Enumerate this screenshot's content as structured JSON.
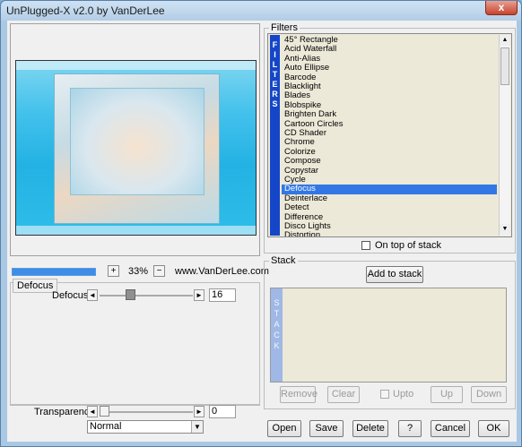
{
  "window": {
    "title": "UnPlugged-X v2.0 by VanDerLee",
    "close_label": "x"
  },
  "preview": {
    "zoom": "33%",
    "zoom_in": "+",
    "zoom_out": "−",
    "website": "www.VanDerLee.com",
    "progress": 1.0
  },
  "defocus_panel": {
    "group_label": "Defocus",
    "param_label": "Defocus",
    "value": "16",
    "left_arrow": "◄",
    "right_arrow": "►"
  },
  "transparency": {
    "label": "Transparency",
    "value": "0",
    "left_arrow": "◄",
    "right_arrow": "►"
  },
  "blend_mode": {
    "selected": "Normal",
    "arrow": "▼"
  },
  "filters": {
    "group_label": "Filters",
    "tab_letters": [
      "F",
      "I",
      "L",
      "T",
      "E",
      "R",
      "S"
    ],
    "items": [
      "45° Rectangle",
      "Acid Waterfall",
      "Anti-Alias",
      "Auto Ellipse",
      "Barcode",
      "Blacklight",
      "Blades",
      "Blobspike",
      "Brighten Dark",
      "Cartoon Circles",
      "CD Shader",
      "Chrome",
      "Colorize",
      "Compose",
      "Copystar",
      "Cycle",
      "Defocus",
      "Deinterlace",
      "Detect",
      "Difference",
      "Disco Lights",
      "Distortion"
    ],
    "selected": "Defocus",
    "on_top_label": "On top of stack",
    "scroll_up": "▲",
    "scroll_down": "▼"
  },
  "stack": {
    "group_label": "Stack",
    "add_button": "Add to stack",
    "tab_letters": [
      "S",
      "T",
      "A",
      "C",
      "K"
    ],
    "remove": "Remove",
    "clear": "Clear",
    "upto": "Upto",
    "up": "Up",
    "down": "Down"
  },
  "footer": {
    "open": "Open",
    "save": "Save",
    "delete": "Delete",
    "help": "?",
    "cancel": "Cancel",
    "ok": "OK"
  }
}
